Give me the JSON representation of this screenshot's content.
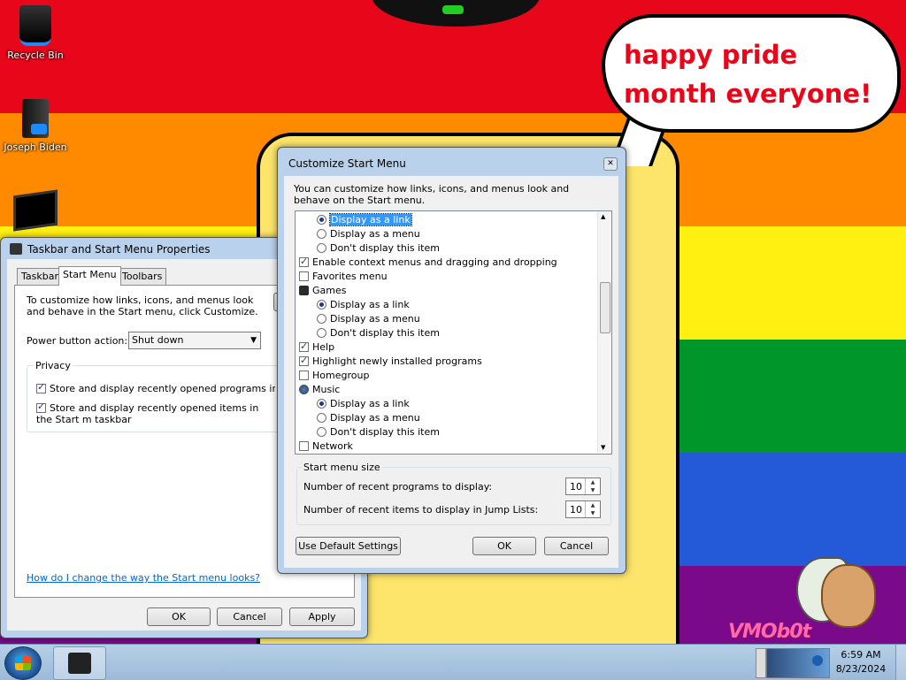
{
  "desktop": {
    "bubble_text": "happy pride month everyone!",
    "watermark": "VMOb0t",
    "icons": [
      {
        "label": "Recycle Bin",
        "icon": "recycle-bin-icon"
      },
      {
        "label": "Joseph Biden",
        "icon": "computer-icon"
      },
      {
        "label": "",
        "icon": "monitor-icon"
      }
    ]
  },
  "taskbar_props": {
    "title": "Taskbar and Start Menu Properties",
    "tabs": [
      "Taskbar",
      "Start Menu",
      "Toolbars"
    ],
    "active_tab": "Start Menu",
    "intro": "To customize how links, icons, and menus look and behave in the Start menu, click Customize.",
    "power_label": "Power button action:",
    "power_value": "Shut down",
    "privacy_label": "Privacy",
    "privacy_items": [
      {
        "label": "Store and display recently opened programs in the Sta",
        "checked": true
      },
      {
        "label": "Store and display recently opened items in the Start m taskbar",
        "checked": true
      }
    ],
    "help_link": "How do I change the way the Start menu looks?",
    "ok": "OK",
    "cancel": "Cancel",
    "apply": "Apply"
  },
  "customize": {
    "title": "Customize Start Menu",
    "description": "You can customize how links, icons, and menus look and behave on the Start menu.",
    "list": [
      {
        "type": "radio",
        "label": "Display as a link",
        "on": true,
        "selected": true
      },
      {
        "type": "radio",
        "label": "Display as a menu",
        "on": false
      },
      {
        "type": "radio",
        "label": "Don't display this item",
        "on": false
      },
      {
        "type": "check",
        "label": "Enable context menus and dragging and dropping",
        "on": true
      },
      {
        "type": "check",
        "label": "Favorites menu",
        "on": false
      },
      {
        "type": "header",
        "label": "Games",
        "icon": "games-icon"
      },
      {
        "type": "radio",
        "label": "Display as a link",
        "on": true
      },
      {
        "type": "radio",
        "label": "Display as a menu",
        "on": false
      },
      {
        "type": "radio",
        "label": "Don't display this item",
        "on": false
      },
      {
        "type": "check",
        "label": "Help",
        "on": true
      },
      {
        "type": "check",
        "label": "Highlight newly installed programs",
        "on": true
      },
      {
        "type": "check",
        "label": "Homegroup",
        "on": false
      },
      {
        "type": "header",
        "label": "Music",
        "icon": "music-icon"
      },
      {
        "type": "radio",
        "label": "Display as a link",
        "on": true
      },
      {
        "type": "radio",
        "label": "Display as a menu",
        "on": false
      },
      {
        "type": "radio",
        "label": "Don't display this item",
        "on": false
      },
      {
        "type": "check",
        "label": "Network",
        "on": false
      }
    ],
    "size_group": "Start menu size",
    "recent_programs_label": "Number of recent programs to display:",
    "recent_programs_value": "10",
    "recent_items_label": "Number of recent items to display in Jump Lists:",
    "recent_items_value": "10",
    "defaults_btn": "Use Default Settings",
    "ok": "OK",
    "cancel": "Cancel"
  },
  "taskbar": {
    "time": "6:59 AM",
    "date": "8/23/2024"
  }
}
